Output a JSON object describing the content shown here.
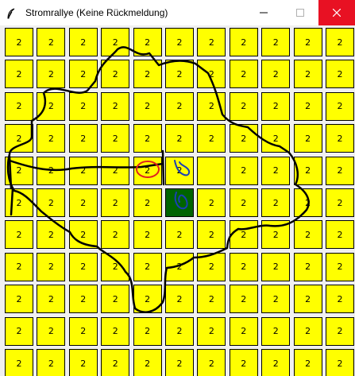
{
  "window": {
    "title": "Stromrallye (Keine Rückmeldung)",
    "app_icon": "feather-icon",
    "controls": {
      "minimize": "minimize-icon",
      "maximize": "maximize-icon",
      "close": "close-icon"
    }
  },
  "board": {
    "rows": 11,
    "cols": 11,
    "default_value": "2",
    "cell_color": "#ffff00",
    "special_cell_color": "#006400",
    "cells": [
      [
        "2",
        "2",
        "2",
        "2",
        "2",
        "2",
        "2",
        "2",
        "2",
        "2",
        "2"
      ],
      [
        "2",
        "2",
        "2",
        "2",
        "2",
        "2",
        "2",
        "2",
        "2",
        "2",
        "2"
      ],
      [
        "2",
        "2",
        "2",
        "2",
        "2",
        "2",
        "2",
        "2",
        "2",
        "2",
        "2"
      ],
      [
        "2",
        "2",
        "2",
        "2",
        "2",
        "2",
        "2",
        "2",
        "2",
        "2",
        "2"
      ],
      [
        "2",
        "2",
        "2",
        "2",
        "2",
        "2",
        "",
        "2",
        "2",
        "2",
        "2"
      ],
      [
        "2",
        "2",
        "2",
        "2",
        "2",
        "",
        "2",
        "2",
        "2",
        "2"
      ],
      [
        "2",
        "2",
        "2",
        "2",
        "2",
        "2",
        "2",
        "2",
        "2",
        "2",
        "2"
      ],
      [
        "2",
        "2",
        "2",
        "2",
        "2",
        "2",
        "2",
        "2",
        "2",
        "2",
        "2"
      ],
      [
        "2",
        "2",
        "2",
        "2",
        "2",
        "2",
        "2",
        "2",
        "2",
        "2",
        "2"
      ],
      [
        "2",
        "2",
        "2",
        "2",
        "2",
        "2",
        "2",
        "2",
        "2",
        "2",
        "2"
      ],
      [
        "2",
        "2",
        "2",
        "2",
        "2",
        "2",
        "2",
        "2",
        "2",
        "2",
        "2"
      ]
    ],
    "special_cell": {
      "row": 5,
      "col": 5
    }
  },
  "annotations": {
    "outline_color": "#000000",
    "circle_color": "#ff0000",
    "scribble_color": "#1a3fb5"
  }
}
